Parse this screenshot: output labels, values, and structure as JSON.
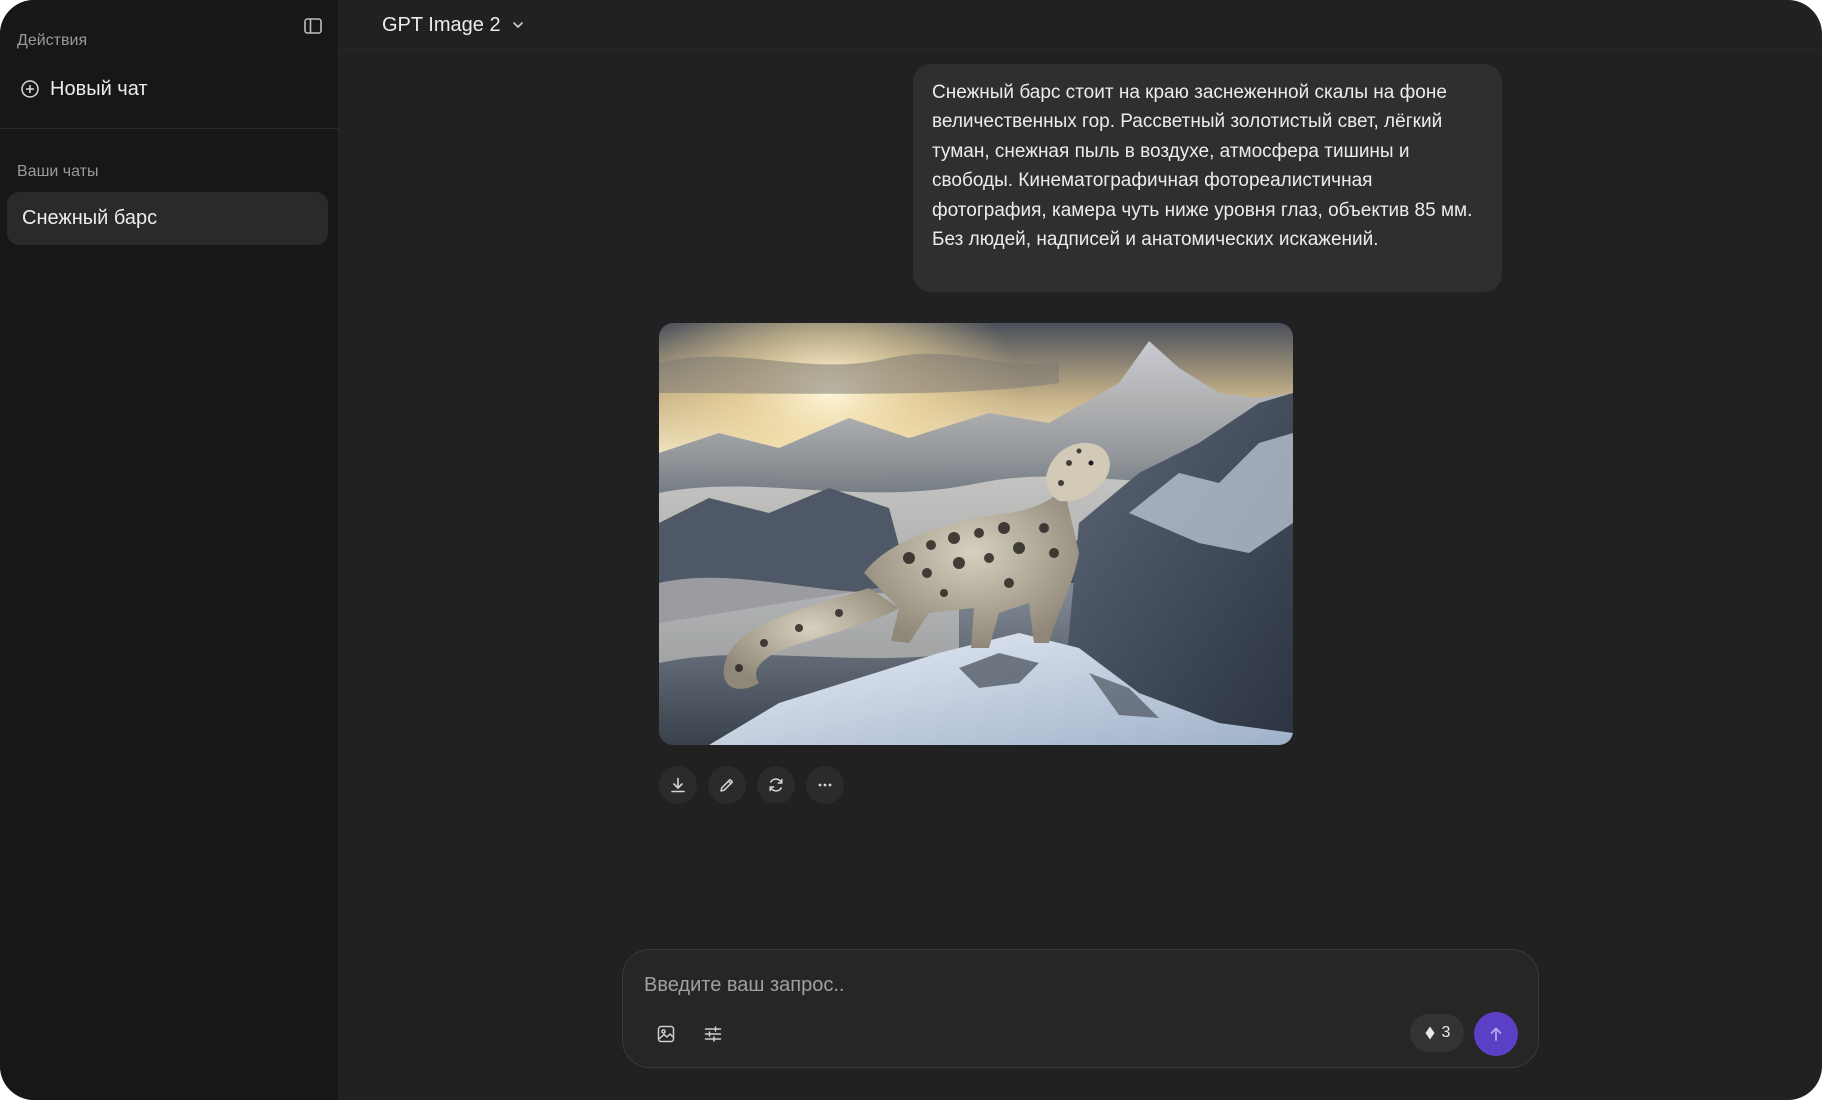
{
  "sidebar": {
    "actions_label": "Действия",
    "new_chat_label": "Новый чат",
    "chats_label": "Ваши чаты",
    "chats": [
      {
        "title": "Снежный барс",
        "active": true
      }
    ],
    "toggle_icon": "sidebar-panel-icon"
  },
  "header": {
    "model_name": "GPT Image 2",
    "model_icon": "chevron-down-icon"
  },
  "conversation": {
    "user_message": "Снежный барс стоит на краю заснеженной скалы на фоне величественных гор. Рассветный золотистый свет, лёгкий туман, снежная пыль в воздухе, атмосфера тишины и свободы. Кинематографичная фотореалистичная фотография, камера чуть ниже уровня глаз, объектив 85 мм. Без людей, надписей и анатомических искажений.",
    "image_actions": [
      "download-icon",
      "edit-icon",
      "regenerate-icon",
      "more-icon"
    ]
  },
  "composer": {
    "placeholder": "Введите ваш запрос..",
    "value": "",
    "credits": "3",
    "credits_icon": "diamond-icon",
    "send_icon": "arrow-up-icon"
  },
  "colors": {
    "background": "#212121",
    "sidebar": "#171717",
    "bubble": "#2f2f2f",
    "accent": "#5b3fc4"
  }
}
